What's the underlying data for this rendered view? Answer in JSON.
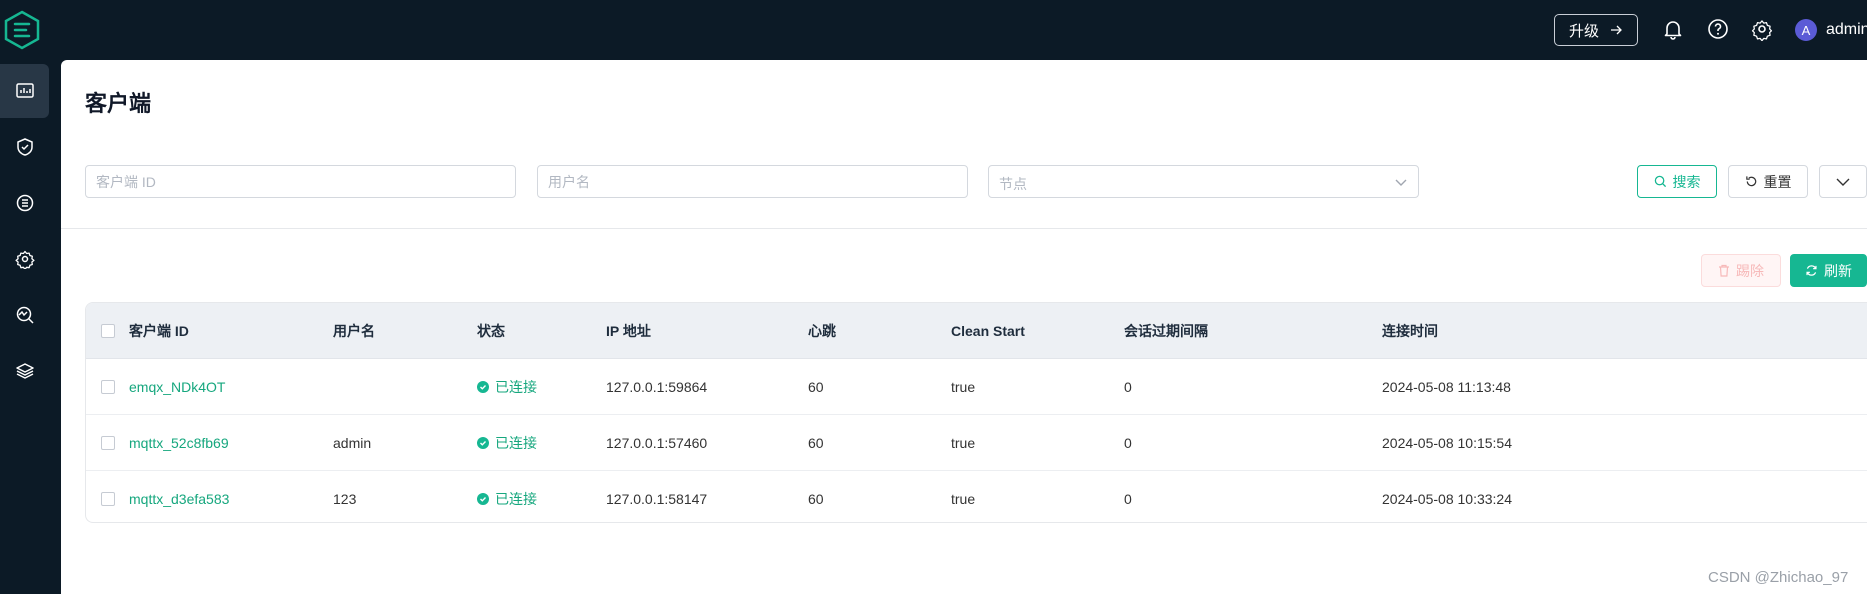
{
  "header": {
    "logo": "emqx-logo-icon",
    "upgrade_label": "升级",
    "icons": [
      "bell-icon",
      "help-icon",
      "gear-icon"
    ],
    "avatar_letter": "A",
    "username": "admin"
  },
  "sidebar": {
    "items": [
      {
        "icon": "dashboard-icon",
        "active": true
      },
      {
        "icon": "shield-icon",
        "active": false
      },
      {
        "icon": "integration-icon",
        "active": false
      },
      {
        "icon": "settings-gear-icon",
        "active": false
      },
      {
        "icon": "monitor-icon",
        "active": false
      },
      {
        "icon": "layers-icon",
        "active": false
      }
    ]
  },
  "page": {
    "title": "客户端"
  },
  "filters": {
    "client_id_placeholder": "客户端 ID",
    "username_placeholder": "用户名",
    "node_placeholder": "节点",
    "search_label": "搜索",
    "reset_label": "重置"
  },
  "actions": {
    "delete_label": "踢除",
    "refresh_label": "刷新"
  },
  "table": {
    "columns": [
      "客户端 ID",
      "用户名",
      "状态",
      "IP 地址",
      "心跳",
      "Clean Start",
      "会话过期间隔",
      "连接时间"
    ],
    "rows": [
      {
        "client_id": "emqx_NDk4OT",
        "username": "",
        "status": "已连接",
        "ip": "127.0.0.1:59864",
        "keepalive": "60",
        "clean_start": "true",
        "expiry": "0",
        "connected_at": "2024-05-08 11:13:48"
      },
      {
        "client_id": "mqttx_52c8fb69",
        "username": "admin",
        "status": "已连接",
        "ip": "127.0.0.1:57460",
        "keepalive": "60",
        "clean_start": "true",
        "expiry": "0",
        "connected_at": "2024-05-08 10:15:54"
      },
      {
        "client_id": "mqttx_d3efa583",
        "username": "123",
        "status": "已连接",
        "ip": "127.0.0.1:58147",
        "keepalive": "60",
        "clean_start": "true",
        "expiry": "0",
        "connected_at": "2024-05-08 10:33:24"
      }
    ]
  },
  "watermark": "CSDN @Zhichao_97",
  "colors": {
    "accent": "#16b792",
    "topbar": "#0c1a26",
    "danger_soft": "#f7b9b9"
  }
}
